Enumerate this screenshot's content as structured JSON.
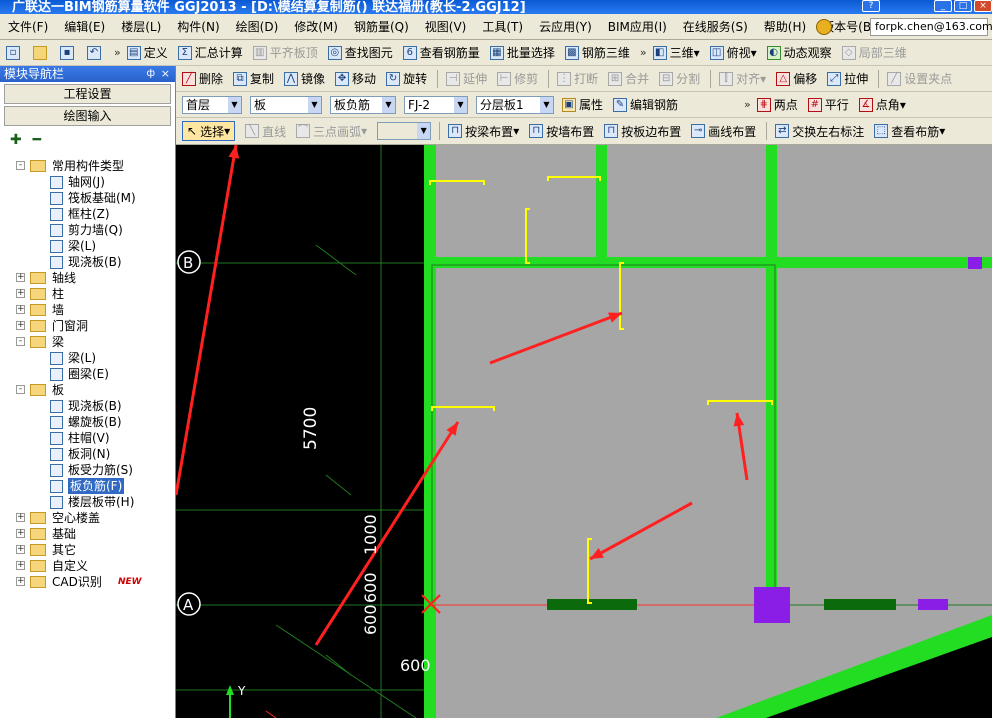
{
  "window": {
    "title": "广联达一BIM钢筋算量软件 GGJ2013 - [D:\\模结算复制筋() 联达福册(教长-2.GGJ12]"
  },
  "menu": {
    "items": [
      "文件(F)",
      "编辑(E)",
      "楼层(L)",
      "构件(N)",
      "绘图(D)",
      "修改(M)",
      "钢筋量(Q)",
      "视图(V)",
      "工具(T)",
      "云应用(Y)",
      "BIM应用(I)",
      "在线服务(S)",
      "帮助(H)",
      "版本号(B)"
    ],
    "account": "forpk.chen@163.com"
  },
  "toolbar1": {
    "items": [
      "定义",
      "汇总计算",
      "平齐板顶",
      "查找图元",
      "查看钢筋量",
      "批量选择",
      "钢筋三维",
      "三维",
      "俯视",
      "动态观察",
      "局部三维"
    ]
  },
  "toolbar2": {
    "items": [
      "删除",
      "复制",
      "镜像",
      "移动",
      "旋转",
      "延伸",
      "修剪",
      "打断",
      "合并",
      "分割",
      "对齐",
      "偏移",
      "拉伸",
      "设置夹点"
    ]
  },
  "toolbar3": {
    "floor": "首层",
    "category": "板",
    "type": "板负筋",
    "name": "FJ-2",
    "layer": "分层板1",
    "property": "属性",
    "edit_rebar": "编辑钢筋",
    "two_points": "两点",
    "parallel": "平行",
    "point_angle": "点角"
  },
  "toolbar4": {
    "select": "选择",
    "line": "直线",
    "arc": "三点画弧",
    "by_beam": "按梁布置",
    "by_wall": "按墙布置",
    "by_slab_edge": "按板边布置",
    "draw_line": "画线布置",
    "swap_label": "交换左右标注",
    "view_layout": "查看布筋"
  },
  "nav": {
    "title": "模块导航栏",
    "btn_project": "工程设置",
    "btn_draw": "绘图输入",
    "tree": [
      {
        "id": "t0",
        "label": "常用构件类型",
        "level": 0,
        "type": "folder",
        "toggle": "-"
      },
      {
        "id": "t1",
        "label": "轴网(J)",
        "level": 1,
        "type": "item"
      },
      {
        "id": "t2",
        "label": "筏板基础(M)",
        "level": 1,
        "type": "item"
      },
      {
        "id": "t3",
        "label": "框柱(Z)",
        "level": 1,
        "type": "item"
      },
      {
        "id": "t4",
        "label": "剪力墙(Q)",
        "level": 1,
        "type": "item"
      },
      {
        "id": "t5",
        "label": "梁(L)",
        "level": 1,
        "type": "item"
      },
      {
        "id": "t6",
        "label": "现浇板(B)",
        "level": 1,
        "type": "item"
      },
      {
        "id": "t7",
        "label": "轴线",
        "level": 0,
        "type": "folder",
        "toggle": "+"
      },
      {
        "id": "t8",
        "label": "柱",
        "level": 0,
        "type": "folder",
        "toggle": "+"
      },
      {
        "id": "t9",
        "label": "墙",
        "level": 0,
        "type": "folder",
        "toggle": "+"
      },
      {
        "id": "t10",
        "label": "门窗洞",
        "level": 0,
        "type": "folder",
        "toggle": "+"
      },
      {
        "id": "t11",
        "label": "梁",
        "level": 0,
        "type": "folder",
        "toggle": "-"
      },
      {
        "id": "t12",
        "label": "梁(L)",
        "level": 1,
        "type": "item"
      },
      {
        "id": "t13",
        "label": "圈梁(E)",
        "level": 1,
        "type": "item"
      },
      {
        "id": "t14",
        "label": "板",
        "level": 0,
        "type": "folder",
        "toggle": "-"
      },
      {
        "id": "t15",
        "label": "现浇板(B)",
        "level": 1,
        "type": "item"
      },
      {
        "id": "t16",
        "label": "螺旋板(B)",
        "level": 1,
        "type": "item"
      },
      {
        "id": "t17",
        "label": "柱帽(V)",
        "level": 1,
        "type": "item"
      },
      {
        "id": "t18",
        "label": "板洞(N)",
        "level": 1,
        "type": "item"
      },
      {
        "id": "t19",
        "label": "板受力筋(S)",
        "level": 1,
        "type": "item"
      },
      {
        "id": "t20",
        "label": "板负筋(F)",
        "level": 1,
        "type": "item",
        "selected": true
      },
      {
        "id": "t21",
        "label": "楼层板带(H)",
        "level": 1,
        "type": "item"
      },
      {
        "id": "t22",
        "label": "空心楼盖",
        "level": 0,
        "type": "folder",
        "toggle": "+"
      },
      {
        "id": "t23",
        "label": "基础",
        "level": 0,
        "type": "folder",
        "toggle": "+"
      },
      {
        "id": "t24",
        "label": "其它",
        "level": 0,
        "type": "folder",
        "toggle": "+"
      },
      {
        "id": "t25",
        "label": "自定义",
        "level": 0,
        "type": "folder",
        "toggle": "+"
      },
      {
        "id": "t26",
        "label": "CAD识别",
        "level": 0,
        "type": "folder",
        "toggle": "+",
        "badge": "NEW"
      }
    ]
  },
  "drawing": {
    "axis_b": "B",
    "axis_a": "A",
    "dim_5700": "5700",
    "dim_1000": "1000",
    "dim_600a": "600",
    "dim_600b": "600",
    "dim_600c": "600",
    "ucs_y": "Y",
    "colors": {
      "background": "#000000",
      "slab": "#a6a6a6",
      "wall": "#22dd22",
      "rebar": "#ffff00",
      "beam_dark": "#0b6b0b",
      "column": "#8a1ee6",
      "annotation_arrow": "#ff2020",
      "grid": "#1f7a1f"
    }
  }
}
